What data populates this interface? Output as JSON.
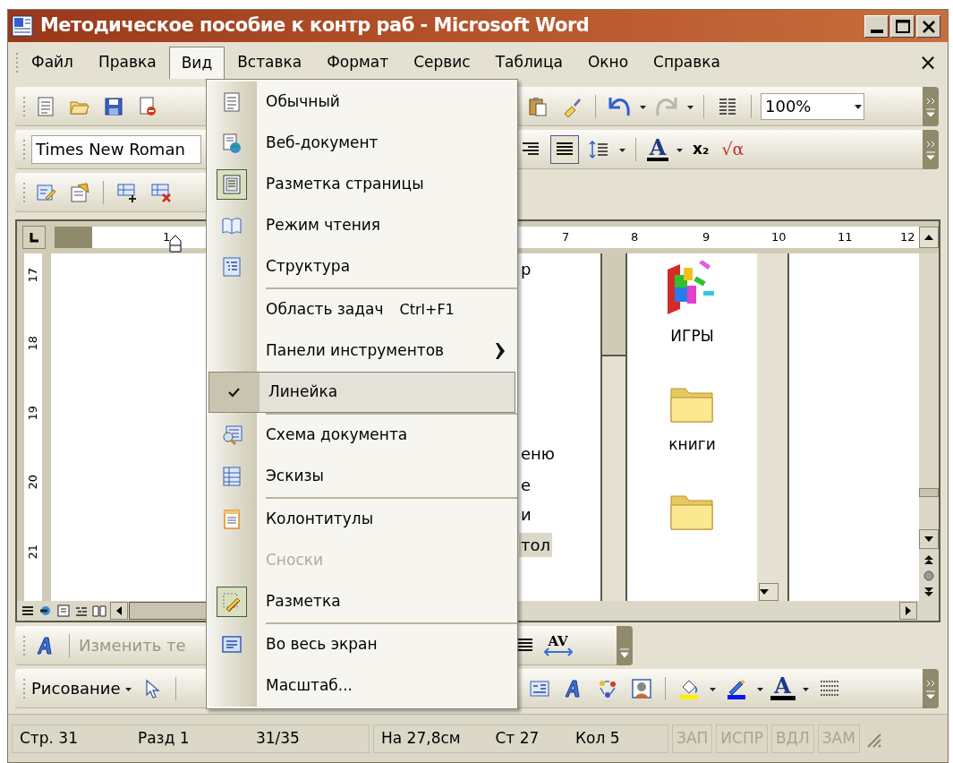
{
  "window": {
    "title": "Методическое пособие к контр раб - Microsoft Word"
  },
  "menu_bar": [
    {
      "label": "Файл",
      "selected": false
    },
    {
      "label": "Правка",
      "selected": false
    },
    {
      "label": "Вид",
      "selected": true
    },
    {
      "label": "Вставка",
      "selected": false
    },
    {
      "label": "Формат",
      "selected": false
    },
    {
      "label": "Сервис",
      "selected": false
    },
    {
      "label": "Таблица",
      "selected": false
    },
    {
      "label": "Окно",
      "selected": false
    },
    {
      "label": "Справка",
      "selected": false
    }
  ],
  "menu_close": "×",
  "standard_toolbar": {
    "zoom": "100%"
  },
  "formatting_toolbar": {
    "font": "Times New Roman",
    "font_color_glyph": "A",
    "subscript_glyph": "x₂",
    "formula_glyph": "√α"
  },
  "view_menu": [
    {
      "label": "Обычный",
      "submenu": false,
      "checked": false,
      "disabled": false,
      "selected": false,
      "on": false,
      "separator_before": false
    },
    {
      "label": "Веб-документ",
      "submenu": false,
      "checked": false,
      "disabled": false,
      "selected": false,
      "on": false,
      "separator_before": false
    },
    {
      "label": "Разметка страницы",
      "submenu": false,
      "checked": false,
      "disabled": false,
      "selected": false,
      "on": true,
      "separator_before": false
    },
    {
      "label": "Режим чтения",
      "submenu": false,
      "checked": false,
      "disabled": false,
      "selected": false,
      "on": false,
      "separator_before": false
    },
    {
      "label": "Структура",
      "submenu": false,
      "checked": false,
      "disabled": false,
      "selected": false,
      "on": false,
      "separator_before": false
    },
    {
      "label": "Область задач",
      "shortcut": "Ctrl+F1",
      "submenu": false,
      "checked": false,
      "disabled": false,
      "selected": false,
      "on": false,
      "separator_before": true
    },
    {
      "label": "Панели инструментов",
      "submenu": true,
      "checked": false,
      "disabled": false,
      "selected": false,
      "on": false,
      "separator_before": false
    },
    {
      "label": "Линейка",
      "submenu": false,
      "checked": true,
      "disabled": false,
      "selected": true,
      "on": false,
      "separator_before": false
    },
    {
      "label": "Схема документа",
      "submenu": false,
      "checked": false,
      "disabled": false,
      "selected": false,
      "on": false,
      "separator_before": true
    },
    {
      "label": "Эскизы",
      "submenu": false,
      "checked": false,
      "disabled": false,
      "selected": false,
      "on": false,
      "separator_before": false
    },
    {
      "label": "Колонтитулы",
      "submenu": false,
      "checked": false,
      "disabled": false,
      "selected": false,
      "on": false,
      "separator_before": true
    },
    {
      "label": "Сноски",
      "submenu": false,
      "checked": false,
      "disabled": true,
      "selected": false,
      "on": false,
      "separator_before": false
    },
    {
      "label": "Разметка",
      "submenu": false,
      "checked": false,
      "disabled": false,
      "selected": false,
      "on": true,
      "separator_before": false
    },
    {
      "label": "Во весь экран",
      "submenu": false,
      "checked": false,
      "disabled": false,
      "selected": false,
      "on": false,
      "separator_before": true
    },
    {
      "label": "Масштаб...",
      "submenu": false,
      "checked": false,
      "disabled": false,
      "selected": false,
      "on": false,
      "separator_before": false
    }
  ],
  "ruler": {
    "horizontal": [
      "1",
      "7",
      "8",
      "9",
      "10",
      "11",
      "12"
    ],
    "vertical": [
      "17",
      "18",
      "19",
      "20",
      "21"
    ]
  },
  "document": {
    "text_fragments": [
      {
        "text": "р",
        "selected": false
      },
      {
        "text": "еню",
        "selected": false
      },
      {
        "text": "е",
        "selected": false
      },
      {
        "text": "и",
        "selected": false
      },
      {
        "text": "тол",
        "selected": true
      }
    ],
    "icons": [
      {
        "label": "ИГРЫ",
        "kind": "games"
      },
      {
        "label": "книги",
        "kind": "folder"
      },
      {
        "kind": "folder"
      }
    ]
  },
  "wordart_toolbar": {
    "edit_text": "Изменить те",
    "spacing_glyph": "AV"
  },
  "drawing_toolbar": {
    "menu": "Рисование",
    "font_color_glyph": "A"
  },
  "status_bar": [
    {
      "text": "Стр. 31",
      "disabled": false
    },
    {
      "text": "Разд 1",
      "disabled": false
    },
    {
      "text": "31/35",
      "disabled": false
    },
    {
      "text": "На 27,8см",
      "disabled": false
    },
    {
      "text": "Ст 27",
      "disabled": false
    },
    {
      "text": "Кол 5",
      "disabled": false
    },
    {
      "text": "ЗАП",
      "disabled": true
    },
    {
      "text": "ИСПР",
      "disabled": true
    },
    {
      "text": "ВДЛ",
      "disabled": true
    },
    {
      "text": "ЗАМ",
      "disabled": true
    }
  ]
}
